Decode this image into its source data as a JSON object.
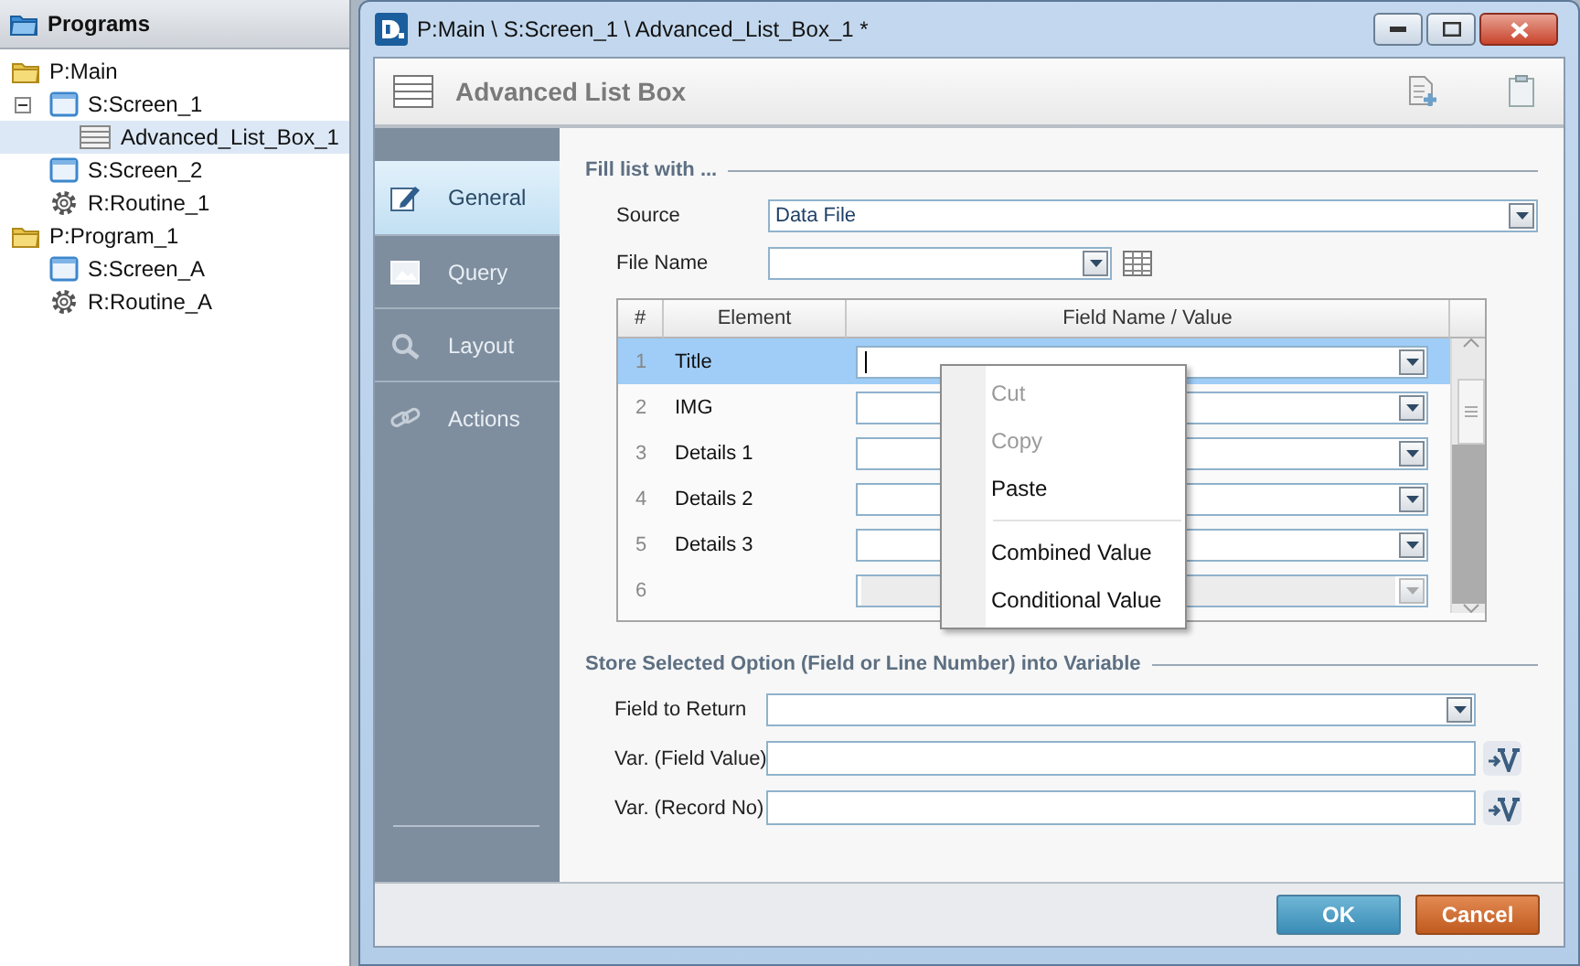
{
  "tree_panel": {
    "title": "Programs",
    "items": [
      {
        "label": "P:Main",
        "kind": "program",
        "selected": false,
        "children": [
          {
            "label": "S:Screen_1",
            "kind": "screen",
            "selected": false,
            "children": [
              {
                "label": "Advanced_List_Box_1",
                "kind": "listbox",
                "selected": true
              }
            ]
          },
          {
            "label": "S:Screen_2",
            "kind": "screen",
            "selected": false
          },
          {
            "label": "R:Routine_1",
            "kind": "routine",
            "selected": false
          }
        ]
      },
      {
        "label": "P:Program_1",
        "kind": "program",
        "selected": false,
        "children": [
          {
            "label": "S:Screen_A",
            "kind": "screen",
            "selected": false
          },
          {
            "label": "R:Routine_A",
            "kind": "routine",
            "selected": false
          }
        ]
      }
    ]
  },
  "window": {
    "title": "P:Main \\ S:Screen_1 \\ Advanced_List_Box_1 *"
  },
  "header": {
    "title": "Advanced List Box"
  },
  "nav": [
    {
      "label": "General",
      "kind": "general",
      "selected": true
    },
    {
      "label": "Query",
      "kind": "query",
      "selected": false
    },
    {
      "label": "Layout",
      "kind": "layout",
      "selected": false
    },
    {
      "label": "Actions",
      "kind": "actions",
      "selected": false
    }
  ],
  "fill_section": {
    "title": "Fill list with ...",
    "source": {
      "label": "Source",
      "value": "Data File"
    },
    "file_name": {
      "label": "File Name"
    }
  },
  "grid": {
    "columns": [
      "#",
      "Element",
      "Field Name / Value"
    ],
    "rows": [
      {
        "number": "1",
        "element": "Title",
        "selected": true,
        "disabled": false
      },
      {
        "number": "2",
        "element": "IMG",
        "selected": false,
        "disabled": false
      },
      {
        "number": "3",
        "element": "Details 1",
        "selected": false,
        "disabled": false
      },
      {
        "number": "4",
        "element": "Details 2",
        "selected": false,
        "disabled": false
      },
      {
        "number": "5",
        "element": "Details 3",
        "selected": false,
        "disabled": false
      },
      {
        "number": "6",
        "selected": false,
        "disabled": true
      }
    ]
  },
  "context_menu": {
    "items": [
      {
        "kind": "item",
        "label": "Cut",
        "disabled": true
      },
      {
        "kind": "item",
        "label": "Copy",
        "disabled": true
      },
      {
        "kind": "item",
        "label": "Paste",
        "disabled": false
      },
      {
        "kind": "separator"
      },
      {
        "kind": "item",
        "label": "Combined Value",
        "disabled": false
      },
      {
        "kind": "item",
        "label": "Conditional Value",
        "disabled": false
      }
    ]
  },
  "store_section": {
    "title": "Store Selected Option (Field or Line Number) into Variable",
    "fields": [
      {
        "label": "Field to Return",
        "kind": "dropdown"
      },
      {
        "label": "Var. (Field Value)",
        "kind": "variable"
      },
      {
        "label": "Var. (Record No)",
        "kind": "variable"
      }
    ]
  },
  "buttons": [
    {
      "label": "OK",
      "kind": "primary"
    },
    {
      "label": "Cancel",
      "kind": "cancel"
    }
  ]
}
